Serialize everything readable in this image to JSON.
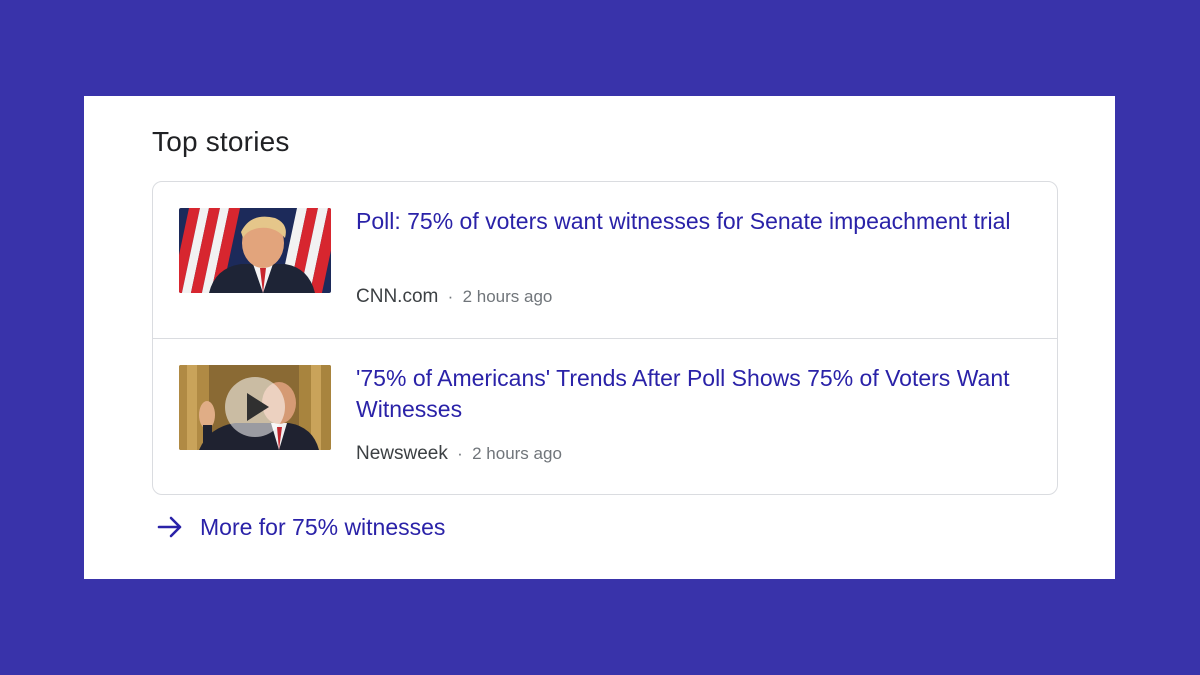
{
  "top_stories": {
    "title": "Top stories",
    "stories": [
      {
        "headline": "Poll: 75% of voters want witnesses for Senate impeachment trial",
        "source": "CNN.com",
        "separator": "·",
        "time": "2 hours ago",
        "thumbnail": "photo",
        "has_video": false
      },
      {
        "headline": "'75% of Americans' Trends After Poll Shows 75% of Voters Want Witnesses",
        "source": "Newsweek",
        "separator": "·",
        "time": "2 hours ago",
        "thumbnail": "video-photo",
        "has_video": true
      }
    ],
    "more_link": {
      "icon": "arrow-right-icon",
      "label": "More for 75% witnesses"
    }
  },
  "colors": {
    "background": "#3933aa",
    "link": "#2a22a8",
    "text": "#202124",
    "muted": "#70757a",
    "border": "#dadce0"
  }
}
